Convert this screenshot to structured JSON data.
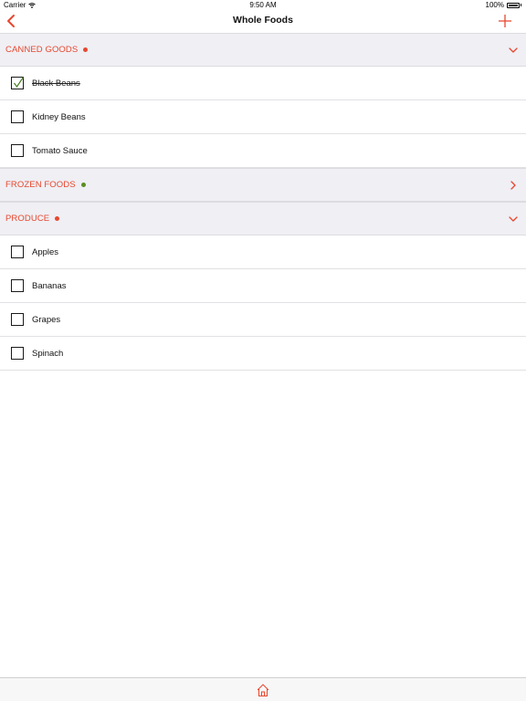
{
  "status_bar": {
    "carrier": "Carrier",
    "time": "9:50 AM",
    "battery": "100%",
    "battery_level": 1.0
  },
  "nav": {
    "title": "Whole Foods"
  },
  "colors": {
    "accent": "#e8472e",
    "green": "#5a8f1e",
    "checkmark": "#4a7d22",
    "header_bg": "#efeff4"
  },
  "sections": [
    {
      "title": "CANNED GOODS",
      "dot_color": "#e8472e",
      "expanded": true,
      "items": [
        {
          "name": "Black Beans",
          "checked": true
        },
        {
          "name": "Kidney Beans",
          "checked": false
        },
        {
          "name": "Tomato Sauce",
          "checked": false
        }
      ]
    },
    {
      "title": "FROZEN FOODS",
      "dot_color": "#5a8f1e",
      "expanded": false,
      "items": []
    },
    {
      "title": "PRODUCE",
      "dot_color": "#e8472e",
      "expanded": true,
      "items": [
        {
          "name": "Apples",
          "checked": false
        },
        {
          "name": "Bananas",
          "checked": false
        },
        {
          "name": "Grapes",
          "checked": false
        },
        {
          "name": "Spinach",
          "checked": false
        }
      ]
    }
  ],
  "toolbar": {
    "icon": "home-icon"
  }
}
